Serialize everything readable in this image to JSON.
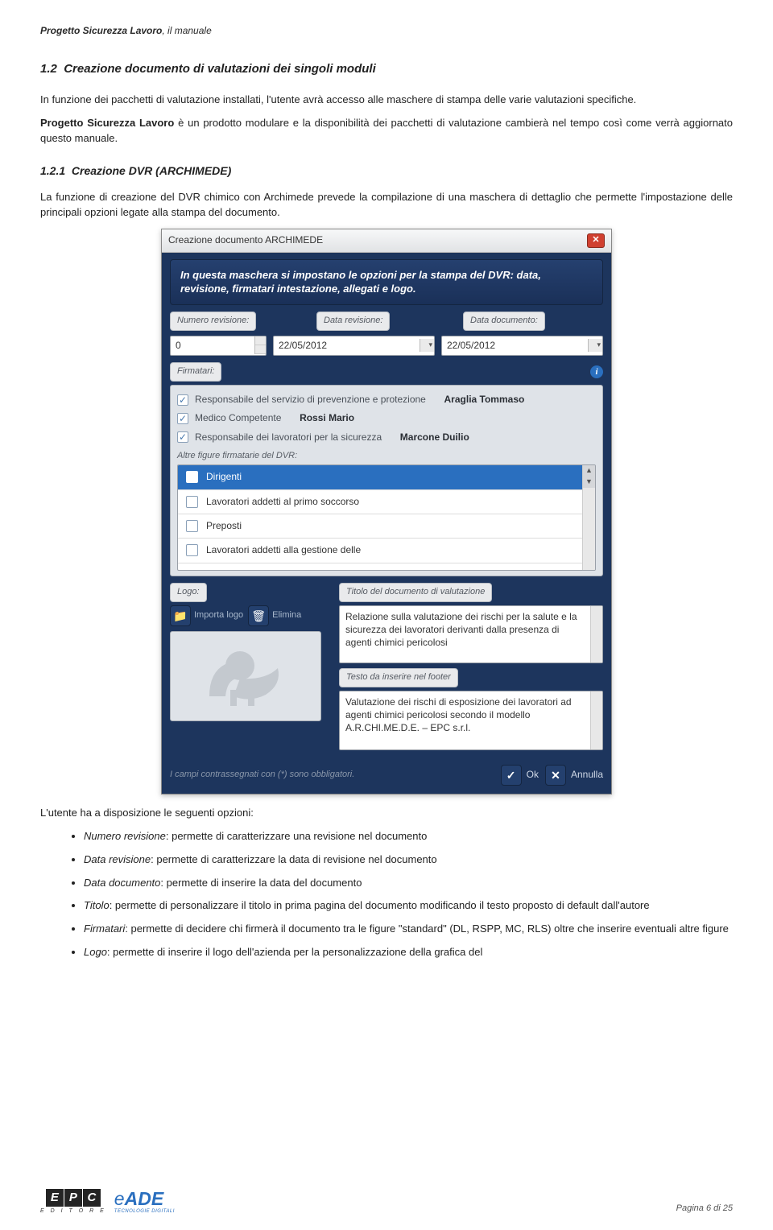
{
  "header": {
    "title_bold": "Progetto Sicurezza Lavoro",
    "title_rest": ", il manuale"
  },
  "section": {
    "num": "1.2",
    "title": "Creazione documento di valutazioni dei singoli moduli",
    "p1": "In funzione dei pacchetti di valutazione installati, l'utente avrà accesso alle maschere di stampa delle varie valutazioni specifiche.",
    "p2_bold": "Progetto Sicurezza Lavoro",
    "p2_rest": " è un prodotto modulare e la disponibilità dei pacchetti di valutazione cambierà nel tempo così come verrà aggiornato questo manuale."
  },
  "subsection": {
    "num": "1.2.1",
    "title": "Creazione DVR (ARCHIMEDE)",
    "p1": "La funzione di creazione del DVR chimico con Archimede prevede la compilazione di una maschera di dettaglio che permette l'impostazione delle principali opzioni legate alla stampa del documento."
  },
  "dialog": {
    "title": "Creazione documento ARCHIMEDE",
    "banner": "In questa maschera si impostano le opzioni per la stampa del DVR: data, revisione, firmatari intestazione, allegati e logo.",
    "labels": {
      "numero_rev": "Numero revisione:",
      "data_rev": "Data revisione:",
      "data_doc": "Data documento:",
      "firmatari": "Firmatari:",
      "altre_figure": "Altre figure firmatarie del DVR:",
      "logo": "Logo:",
      "titolo_doc": "Titolo del documento di valutazione",
      "footer_text": "Testo da inserire nel footer"
    },
    "values": {
      "numero_rev": "0",
      "data_rev": "22/05/2012",
      "data_doc": "22/05/2012"
    },
    "firmatari_rows": [
      {
        "checked": true,
        "role": "Responsabile del servizio di prevenzione e protezione",
        "name": "Araglia Tommaso"
      },
      {
        "checked": true,
        "role": "Medico Competente",
        "name": "Rossi Mario"
      },
      {
        "checked": true,
        "role": "Responsabile dei lavoratori per la sicurezza",
        "name": "Marcone Duilio"
      }
    ],
    "altre_rows": [
      {
        "selected": true,
        "label": "Dirigenti"
      },
      {
        "selected": false,
        "label": "Lavoratori addetti al primo soccorso"
      },
      {
        "selected": false,
        "label": "Preposti"
      },
      {
        "selected": false,
        "label": "Lavoratori addetti alla gestione delle"
      }
    ],
    "logo_buttons": {
      "importa": "Importa logo",
      "elimina": "Elimina"
    },
    "titolo_value": "Relazione sulla valutazione dei rischi per la salute e la sicurezza dei lavoratori  derivanti dalla presenza di agenti chimici pericolosi",
    "footer_value": "Valutazione dei rischi di esposizione dei lavoratori ad agenti chimici pericolosi secondo il modello A.R.CHI.ME.D.E. – EPC s.r.l.",
    "hint": "I campi contrassegnati con (*) sono obbligatori.",
    "ok": "Ok",
    "annulla": "Annulla"
  },
  "options_intro": "L'utente ha a disposizione le seguenti opzioni:",
  "options": [
    {
      "name": "Numero revisione",
      "desc": ": permette di caratterizzare una revisione nel documento"
    },
    {
      "name": "Data revisione",
      "desc": ": permette di caratterizzare la data di revisione nel documento"
    },
    {
      "name": "Data documento",
      "desc": ": permette di inserire la data del documento"
    },
    {
      "name": "Titolo",
      "desc": ": permette di personalizzare il titolo in prima pagina del documento modificando il testo proposto di default dall'autore"
    },
    {
      "name": "Firmatari",
      "desc": ": permette di decidere chi firmerà il documento tra le figure \"standard\" (DL, RSPP, MC, RLS) oltre che inserire eventuali altre figure"
    },
    {
      "name": "Logo",
      "desc": ": permette di inserire il logo dell'azienda per la personalizzazione della grafica del"
    }
  ],
  "footer": {
    "page": "Pagina 6 di 25",
    "epc": "EPC",
    "epc_sub": "E D I T O R E",
    "eade": "eADE",
    "eade_sub": "TECNOLOGIE DIGITALI"
  }
}
